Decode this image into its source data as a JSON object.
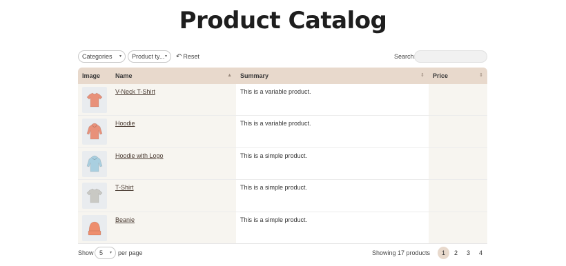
{
  "page": {
    "title": "Product Catalog"
  },
  "filters": {
    "categories": {
      "label": "Categories",
      "caret_icon": "chevron-down-icon"
    },
    "product_type": {
      "label": "Product ty...",
      "caret_icon": "chevron-down-icon"
    },
    "reset": {
      "label": "Reset",
      "icon": "undo-icon"
    },
    "search": {
      "label": "Search:",
      "value": "",
      "placeholder": ""
    }
  },
  "table": {
    "headers": [
      {
        "label": "Image",
        "sortable": false
      },
      {
        "label": "Name",
        "sortable": true
      },
      {
        "label": "Summary",
        "sortable": true
      },
      {
        "label": "Price",
        "sortable": true
      }
    ],
    "rows": [
      {
        "name": "V-Neck T-Shirt",
        "summary": "This is a variable product.",
        "price": "",
        "image_icon": "tshirt-icon",
        "image_color": "#e8917a"
      },
      {
        "name": "Hoodie",
        "summary": "This is a variable product.",
        "price": "",
        "image_icon": "hoodie-icon",
        "image_color": "#e8917a"
      },
      {
        "name": "Hoodie with Logo",
        "summary": "This is a simple product.",
        "price": "",
        "image_icon": "hoodie-icon",
        "image_color": "#a9cfe0"
      },
      {
        "name": "T-Shirt",
        "summary": "This is a simple product.",
        "price": "",
        "image_icon": "tshirt-icon",
        "image_color": "#c9c9c4"
      },
      {
        "name": "Beanie",
        "summary": "This is a simple product.",
        "price": "",
        "image_icon": "beanie-icon",
        "image_color": "#ee8e6e"
      }
    ]
  },
  "footer": {
    "show_label": "Show",
    "per_page_value": "5",
    "per_page_label": "per page",
    "showing_text": "Showing 17 products",
    "pages": [
      "1",
      "2",
      "3",
      "4"
    ],
    "current_page": "1"
  },
  "colors": {
    "header_bg": "#e8d9cc",
    "link": "#4a3b32",
    "active_page": "#e8d9cc"
  }
}
